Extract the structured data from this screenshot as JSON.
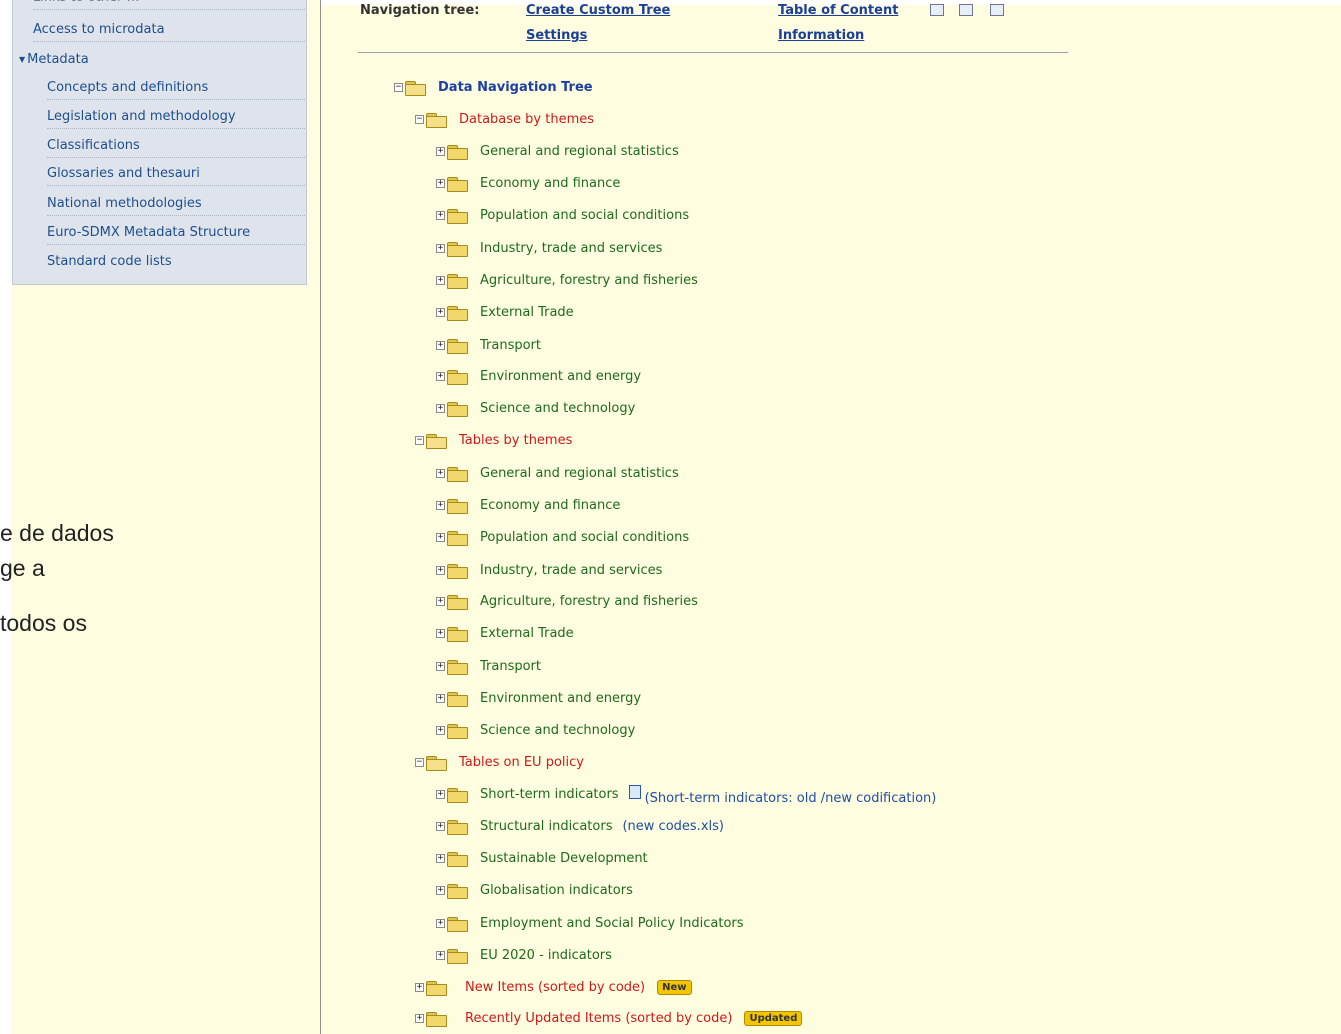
{
  "sidebar": {
    "top_partial": "Links to other …",
    "access_microdata": "Access to microdata",
    "metadata_heading": "Metadata",
    "metadata_items": [
      "Concepts and definitions",
      "Legislation and methodology",
      "Classifications",
      "Glossaries and thesauri",
      "National methodologies",
      "Euro-SDMX Metadata Structure",
      "Standard code lists"
    ]
  },
  "slide_text": [
    "e de dados",
    "ge a",
    " todos os"
  ],
  "header": {
    "nav_tree_label": "Navigation tree:",
    "create_custom_tree": "Create Custom Tree",
    "settings": "Settings",
    "table_of_content": "Table of Content",
    "information": "Information"
  },
  "tree": {
    "root": "Data Navigation Tree",
    "database_by_themes": {
      "label": "Database by themes",
      "items": [
        "General and regional statistics",
        "Economy and finance",
        "Population and social conditions",
        "Industry, trade and services",
        "Agriculture, forestry and fisheries",
        "External Trade",
        "Transport",
        "Environment and energy",
        "Science and technology"
      ]
    },
    "tables_by_themes": {
      "label": "Tables by themes",
      "items": [
        "General and regional statistics",
        "Economy and finance",
        "Population and social conditions",
        "Industry, trade and services",
        "Agriculture, forestry and fisheries",
        "External Trade",
        "Transport",
        "Environment and energy",
        "Science and technology"
      ]
    },
    "tables_on_eu_policy": {
      "label": "Tables on EU policy",
      "items": [
        "Short-term indicators",
        "Structural indicators",
        "Sustainable Development",
        "Globalisation indicators",
        "Employment and Social Policy Indicators",
        "EU 2020 - indicators"
      ],
      "short_term_link": "(Short-term indicators: old /new codification)",
      "structural_link": "(new codes.xls)"
    },
    "new_items": "New Items (sorted by code)",
    "new_badge": "New",
    "recently_updated": "Recently Updated Items (sorted by code)",
    "updated_badge": "Updated"
  }
}
